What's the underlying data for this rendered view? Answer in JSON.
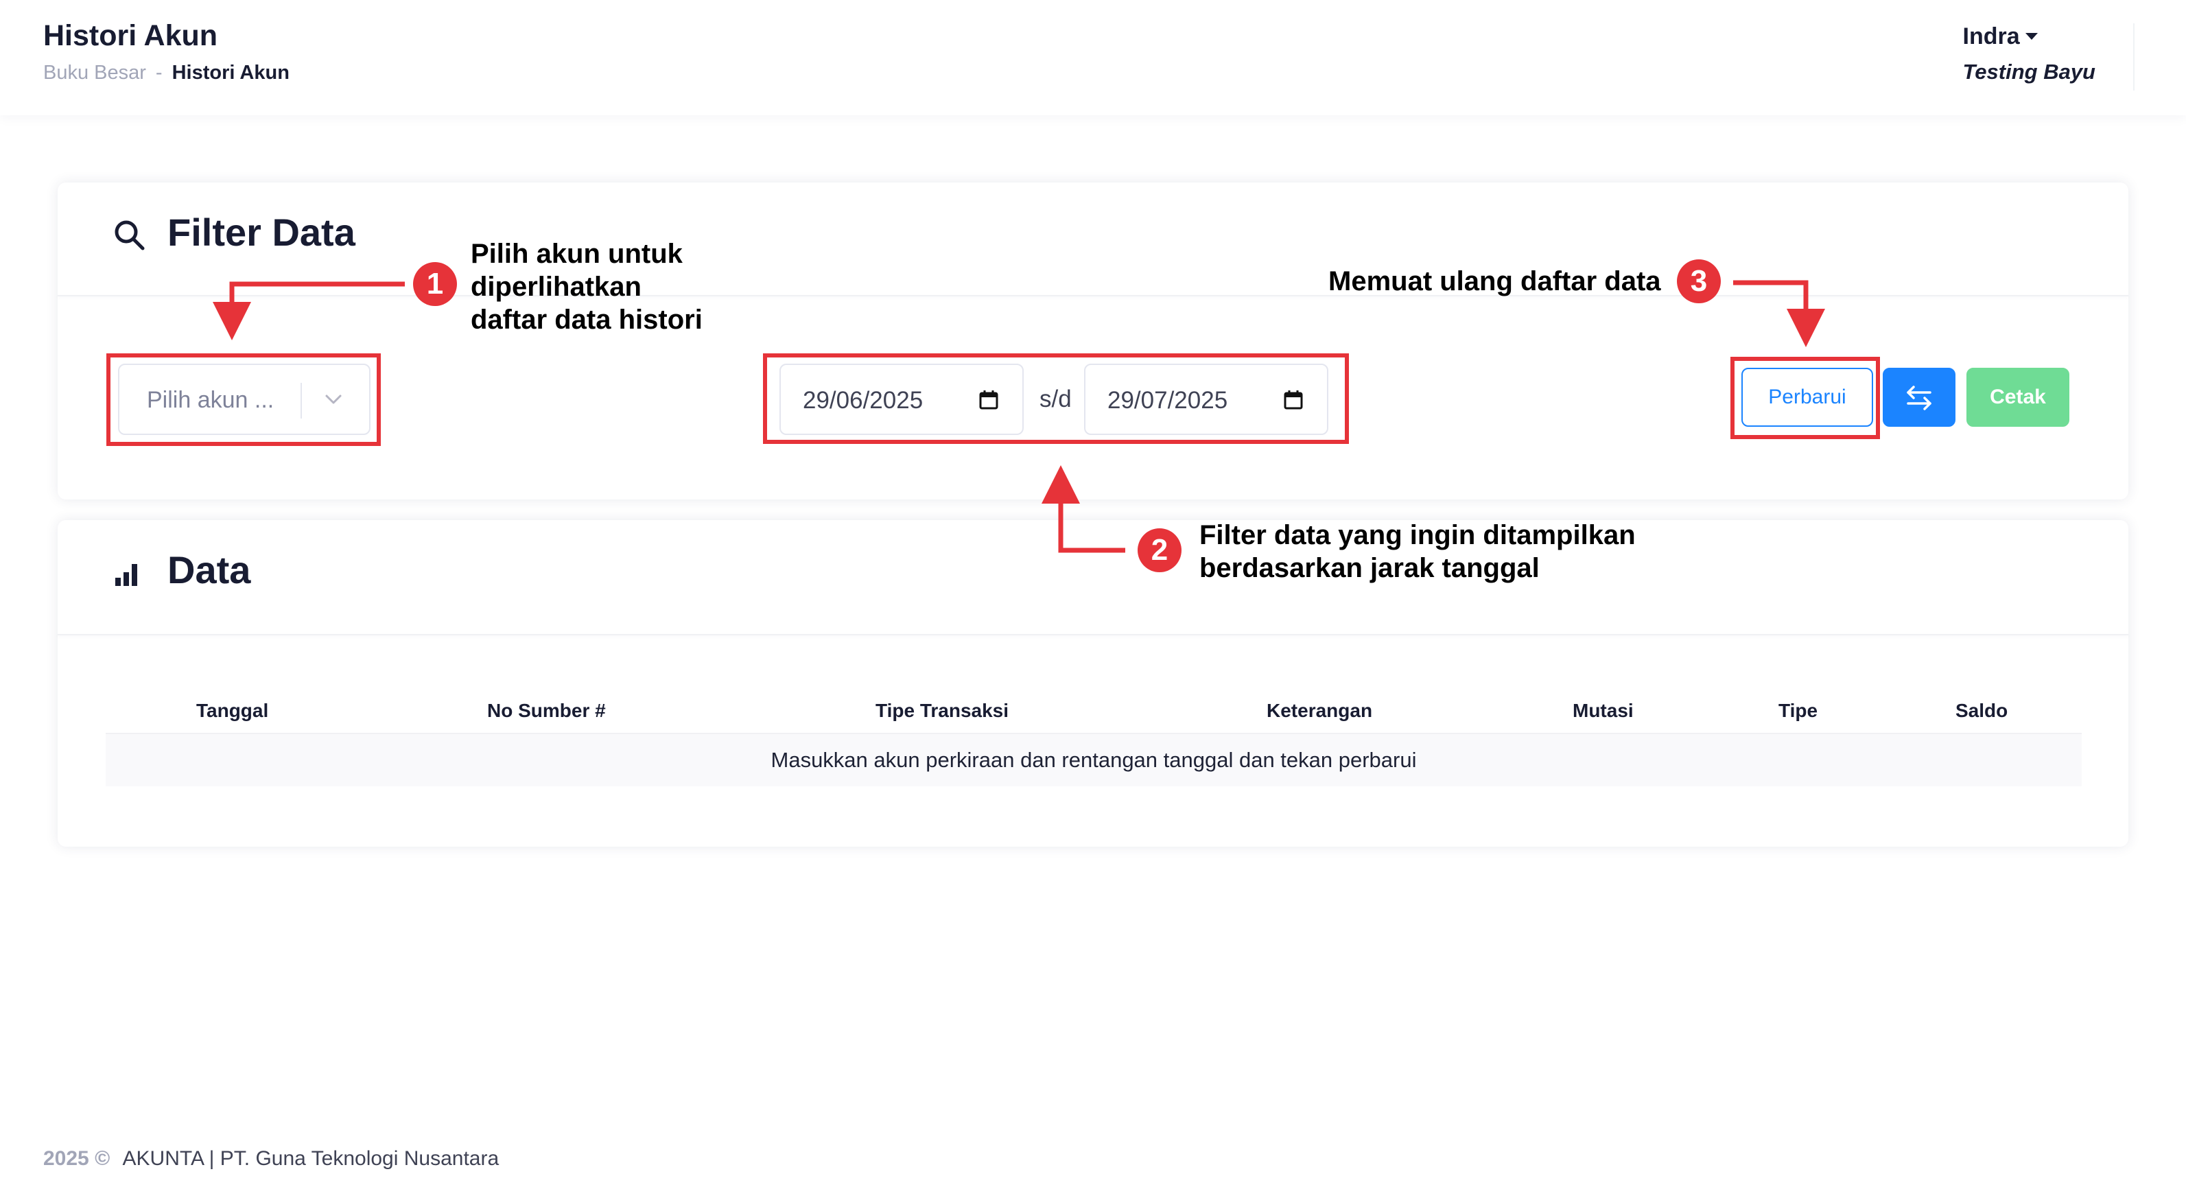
{
  "header": {
    "title": "Histori Akun",
    "breadcrumb": {
      "parent": "Buku Besar",
      "separator": "-",
      "current": "Histori Akun"
    },
    "user": {
      "name": "Indra",
      "company": "Testing Bayu"
    }
  },
  "filter_card": {
    "title": "Filter Data",
    "icon": "search-icon",
    "account_select_placeholder": "Pilih akun ...",
    "date_from": "29/06/2025",
    "date_separator": "s/d",
    "date_to": "29/07/2025",
    "refresh_label": "Perbarui",
    "swap_icon": "swap-arrows-icon",
    "print_label": "Cetak"
  },
  "data_card": {
    "title": "Data",
    "icon": "bar-chart-icon",
    "columns": [
      "Tanggal",
      "No Sumber #",
      "Tipe Transaksi",
      "Keterangan",
      "Mutasi",
      "Tipe",
      "Saldo"
    ],
    "empty_message": "Masukkan akun perkiraan dan rentangan tanggal dan tekan perbarui"
  },
  "footer": {
    "year": "2025 ©",
    "brand": "AKUNTA | PT. Guna Teknologi Nusantara"
  },
  "annotations": [
    {
      "number": "1",
      "text": [
        "Pilih akun untuk",
        "diperlihatkan",
        "daftar data histori"
      ]
    },
    {
      "number": "2",
      "text": [
        "Filter data yang ingin ditampilkan",
        "berdasarkan jarak tanggal"
      ]
    },
    {
      "number": "3",
      "text": [
        "Memuat ulang daftar data"
      ]
    }
  ],
  "colors": {
    "primary": "#1b84ff",
    "success": "#6fdc95",
    "annotation": "#e63339",
    "heading": "#181c32"
  }
}
